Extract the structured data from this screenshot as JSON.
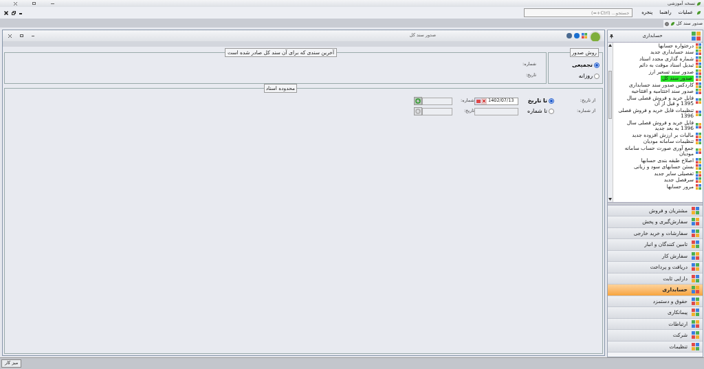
{
  "app_title": "نسخه آموزشی",
  "menu": [
    {
      "label": "عملیات"
    },
    {
      "label": "راهنما"
    },
    {
      "label": "پنجره"
    }
  ],
  "search": {
    "placeholder": "جستجو... (Ctrl+=)"
  },
  "doc_tabs": [
    {
      "label": "صدور سند کل",
      "selected": true
    }
  ],
  "window": {
    "title": "صدور سند کل"
  },
  "issue_method": {
    "legend": "روش صدور",
    "options": [
      {
        "label": "تجمیعی",
        "selected": true
      },
      {
        "label": "روزانه",
        "selected": false
      }
    ]
  },
  "last_doc": {
    "legend": "آخرین سندی که برای آن سند کل صادر شده است",
    "fields": [
      {
        "label": "شماره:"
      },
      {
        "label": "تاریخ:"
      }
    ]
  },
  "range": {
    "legend": "محدوده اسناد",
    "rows": [
      {
        "label": "از تاریخ:",
        "option": "تا تاریخ",
        "selected": true,
        "kind": "date",
        "value": "1402/07/13",
        "field_label": "شماره:",
        "refresh_disabled": false
      },
      {
        "label": "از شماره:",
        "option": "تا شماره",
        "selected": false,
        "kind": "number",
        "field_label": "تاریخ:",
        "refresh_disabled": true
      }
    ]
  },
  "sidebar": {
    "title": "حسابداری",
    "items": [
      {
        "label": "درختواره حسابها",
        "selected": false
      },
      {
        "label": "سند حسابداری جدید",
        "selected": false
      },
      {
        "label": "شماره گذاری مجدد اسناد",
        "selected": false
      },
      {
        "label": "تبدیل اسناد موقت به دائم",
        "selected": false
      },
      {
        "label": "صدور سند تسعیر ارز",
        "selected": false
      },
      {
        "label": "صدور سند کل",
        "selected": true
      },
      {
        "label": "کاردکس صدور سند حسابداری",
        "selected": false
      },
      {
        "label": "صدور سند اختتامیه و افتتاحیه",
        "selected": false
      },
      {
        "label": "فایل خرید و فروش فصلی سال 1395 و قبل از آن",
        "selected": false
      },
      {
        "label": "تنظیمات فایل خرید و فروش فصلی 1396",
        "selected": false
      },
      {
        "label": "فایل خرید و فروش فصلی سال 1396 به بعد جدید",
        "selected": false
      },
      {
        "label": "مالیات بر ارزش افزوده جدید",
        "selected": false
      },
      {
        "label": "تنظیمات سامانه مودیان",
        "selected": false
      },
      {
        "label": "جمع آوری صورت حساب سامانه مودیان",
        "selected": false
      },
      {
        "label": "اصلاح طبقه بندی حسابها",
        "selected": false
      },
      {
        "label": "بستن حسابهای سود و زیانی",
        "selected": false
      },
      {
        "label": "تفصیلی سایر جدید",
        "selected": false
      },
      {
        "label": "سرفصل جدید",
        "selected": false
      },
      {
        "label": "مرور حسابها",
        "selected": false
      }
    ]
  },
  "modules": [
    {
      "label": "مشتریان و فروش",
      "selected": false
    },
    {
      "label": "سفارش‌گیری و پخش",
      "selected": false
    },
    {
      "label": "سفارشات و خرید خارجی",
      "selected": false
    },
    {
      "label": "تامین کنندگان و انبار",
      "selected": false
    },
    {
      "label": "سفارش کار",
      "selected": false
    },
    {
      "label": "دریافت و پرداخت",
      "selected": false
    },
    {
      "label": "دارایی ثابت",
      "selected": false
    },
    {
      "label": "حسابداری",
      "selected": true
    },
    {
      "label": "حقوق و دستمزد",
      "selected": false
    },
    {
      "label": "پیمانکاری",
      "selected": false
    },
    {
      "label": "ارتباطات",
      "selected": false
    },
    {
      "label": "شرکت",
      "selected": false
    },
    {
      "label": "تنظیمات",
      "selected": false
    }
  ],
  "status_bar": {
    "button": "میز کار"
  }
}
